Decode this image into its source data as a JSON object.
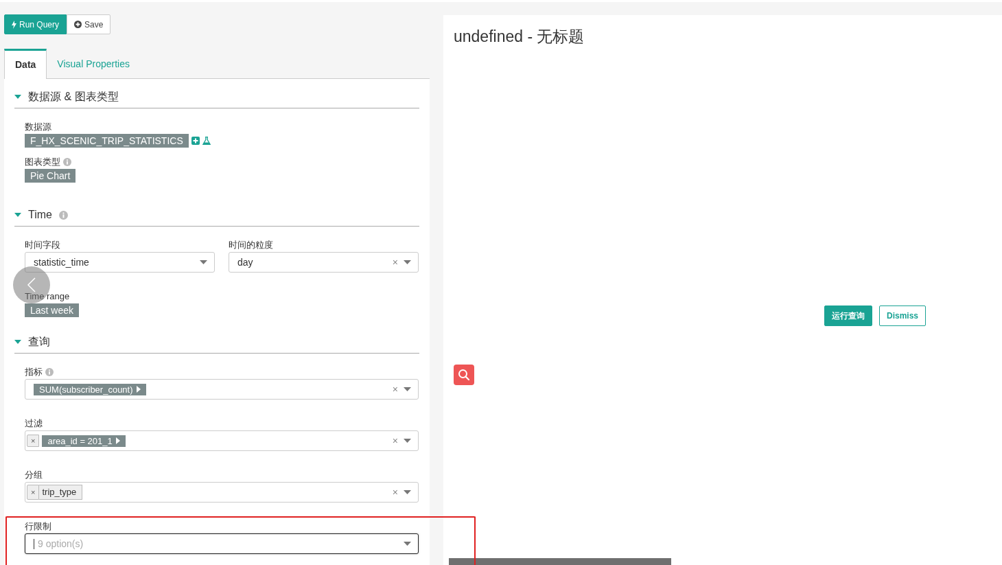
{
  "toolbar": {
    "buttons": [
      {
        "label": "Run Query",
        "kind": "primary"
      },
      {
        "label": "Save",
        "kind": "default"
      }
    ]
  },
  "tabs": [
    {
      "label": "Data",
      "selected": true
    },
    {
      "label": "Visual Properties",
      "selected": false
    }
  ],
  "sections": [
    {
      "title": "数据源 & 图表类型",
      "expanded": true,
      "rows": [
        [
          {
            "kind": "datasource",
            "label": "数据源",
            "tag": "F_HX_SCENIC_TRIP_STATISTICS"
          }
        ],
        [
          {
            "kind": "tag",
            "label": "图表类型",
            "info": true,
            "tag": "Pie Chart"
          }
        ]
      ]
    },
    {
      "title": "Time",
      "expanded": true,
      "info": true,
      "rows": [
        [
          {
            "kind": "select",
            "label": "时间字段",
            "value": "statistic_time"
          },
          {
            "kind": "select",
            "label": "时间的粒度",
            "value": "day",
            "clear": "×"
          }
        ],
        [
          {
            "kind": "tag",
            "label": "Time range",
            "tag": "Last week"
          }
        ]
      ]
    },
    {
      "title": "查询",
      "expanded": true,
      "rows": [
        [
          {
            "kind": "multi",
            "label": "指标",
            "info": true,
            "clear": "×",
            "items": [
              {
                "kind": "metric",
                "text": "SUM(subscriber_count)",
                "menu": true
              }
            ]
          }
        ],
        [
          {
            "kind": "multi",
            "label": "过滤",
            "clear": "×",
            "items": [
              {
                "kind": "filter",
                "text": "area_id = 201_1",
                "remove": "×",
                "menu": true
              }
            ]
          }
        ],
        [
          {
            "kind": "multi",
            "label": "分组",
            "clear": "×",
            "items": [
              {
                "kind": "column",
                "text": "trip_type",
                "remove": "×"
              }
            ]
          }
        ],
        [
          {
            "kind": "select",
            "label": "行限制",
            "placeholder": "9 option(s)",
            "focused": true
          }
        ]
      ]
    }
  ],
  "chart": {
    "title": "undefined - 无标题",
    "buttons": [
      {
        "label": "运行查询",
        "kind": "primary"
      },
      {
        "label": "Dismiss",
        "kind": "outline"
      }
    ]
  }
}
